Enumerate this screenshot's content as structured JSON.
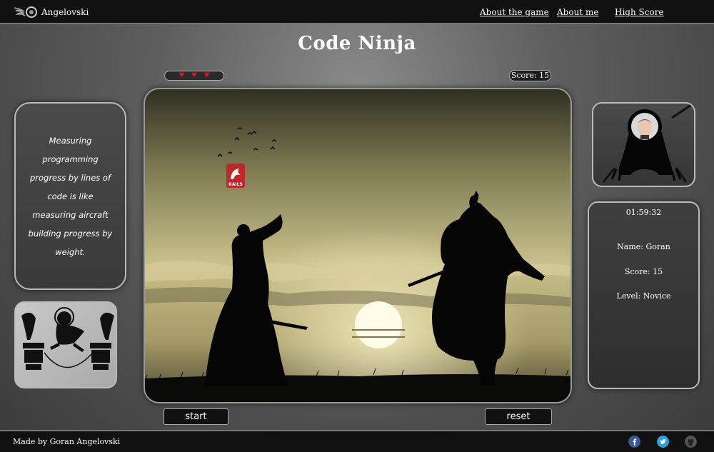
{
  "nav": {
    "brand": "Angelovski",
    "links": [
      "About the game",
      "About me",
      "High Score"
    ]
  },
  "title": "Code Ninja",
  "hud": {
    "lives": 3,
    "score_label": "Score: 15"
  },
  "quote": "Measuring programming progress by lines of code is like measuring aircraft building progress by weight.",
  "game": {
    "falling_item": "RAILS"
  },
  "player": {
    "timer": "01:59:32",
    "name": "Name: Goran",
    "score": "Score: 15",
    "level": "Level: Novice"
  },
  "buttons": {
    "start": "start",
    "reset": "reset"
  },
  "footer": {
    "credit": "Made by Goran Angelovski",
    "social_icons": [
      "facebook-icon",
      "twitter-icon",
      "github-icon"
    ]
  },
  "colors": {
    "heart": "#e0141e",
    "rails": "#c0262b",
    "facebook": "#3b5998",
    "twitter": "#2aa3e0"
  }
}
